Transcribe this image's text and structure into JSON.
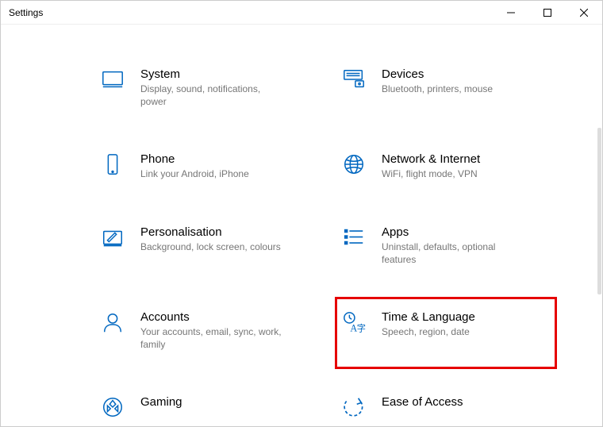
{
  "window": {
    "title": "Settings"
  },
  "tiles": {
    "system": {
      "label": "System",
      "desc": "Display, sound, notifications, power"
    },
    "devices": {
      "label": "Devices",
      "desc": "Bluetooth, printers, mouse"
    },
    "phone": {
      "label": "Phone",
      "desc": "Link your Android, iPhone"
    },
    "network": {
      "label": "Network & Internet",
      "desc": "WiFi, flight mode, VPN"
    },
    "personal": {
      "label": "Personalisation",
      "desc": "Background, lock screen, colours"
    },
    "apps": {
      "label": "Apps",
      "desc": "Uninstall, defaults, optional features"
    },
    "accounts": {
      "label": "Accounts",
      "desc": "Your accounts, email, sync, work, family"
    },
    "time": {
      "label": "Time & Language",
      "desc": "Speech, region, date"
    },
    "gaming": {
      "label": "Gaming",
      "desc": ""
    },
    "ease": {
      "label": "Ease of Access",
      "desc": ""
    }
  }
}
